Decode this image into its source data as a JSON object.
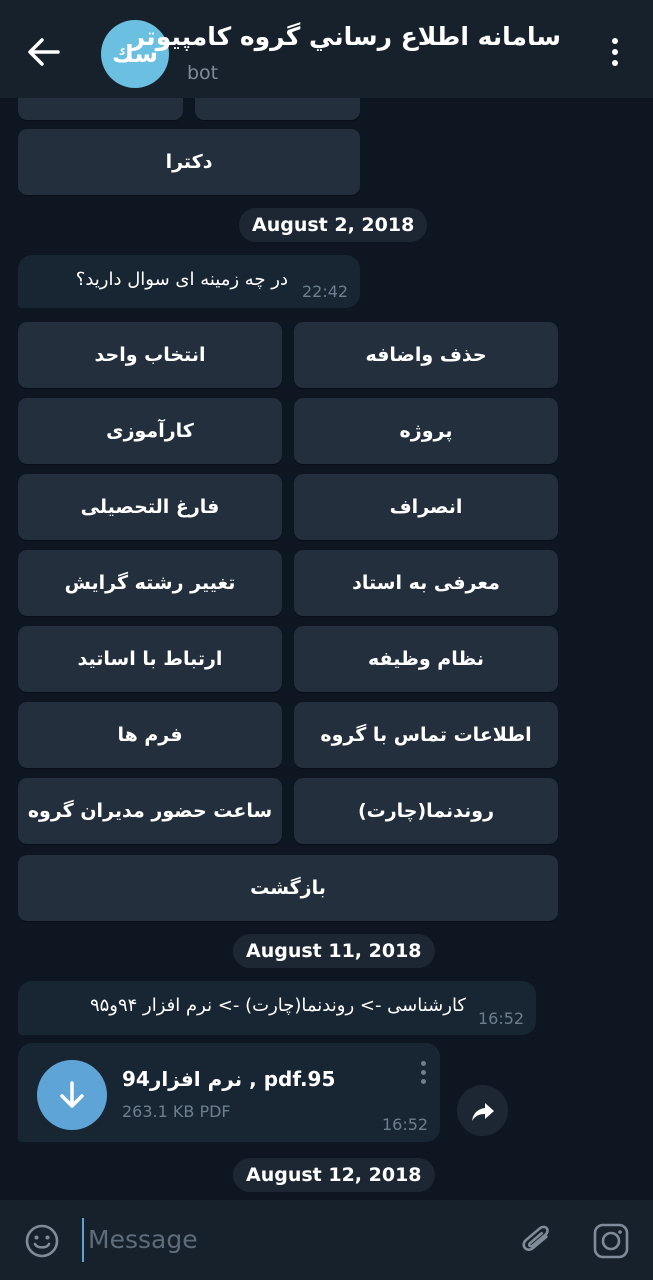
{
  "header": {
    "title": "سامانه اطلاع رساني گروه كامپيوتر",
    "subtitle": "bot",
    "avatar_initials": "سك",
    "avatar_color": "#6bc0e2"
  },
  "top_keyboard": {
    "button": "دکترا"
  },
  "dates": [
    "August 2, 2018",
    "August 11, 2018",
    "August 12, 2018"
  ],
  "question": {
    "text": "در چه زمینه ای سوال دارید؟",
    "time": "22:42"
  },
  "keyboard": [
    [
      "انتخاب واحد",
      "حذف واضافه"
    ],
    [
      "کارآموزی",
      "پروژه"
    ],
    [
      "فارغ التحصیلی",
      "انصراف"
    ],
    [
      "تغییر رشته گرایش",
      "معرفی به استاد"
    ],
    [
      "ارتباط با اساتید",
      "نظام وظیفه"
    ],
    [
      "فرم ها",
      "اطلاعات تماس با گروه"
    ],
    [
      "ساعت حضور مدیران گروه",
      "روندنما(چارت)"
    ]
  ],
  "back_button": "بازگشت",
  "path_message": {
    "text": "کارشناسی -> روندنما(چارت) -> نرم افزار ۹۴و۹۵",
    "time": "16:52"
  },
  "file": {
    "name": "نرم افزار94 , pdf.95",
    "meta": "263.1 KB PDF",
    "time": "16:52"
  },
  "input": {
    "placeholder": "Message"
  },
  "colors": {
    "background": "#0e1621",
    "header": "#17212b",
    "bubble": "#182533",
    "button": "#232f3c",
    "accent": "#5fa4d7"
  }
}
